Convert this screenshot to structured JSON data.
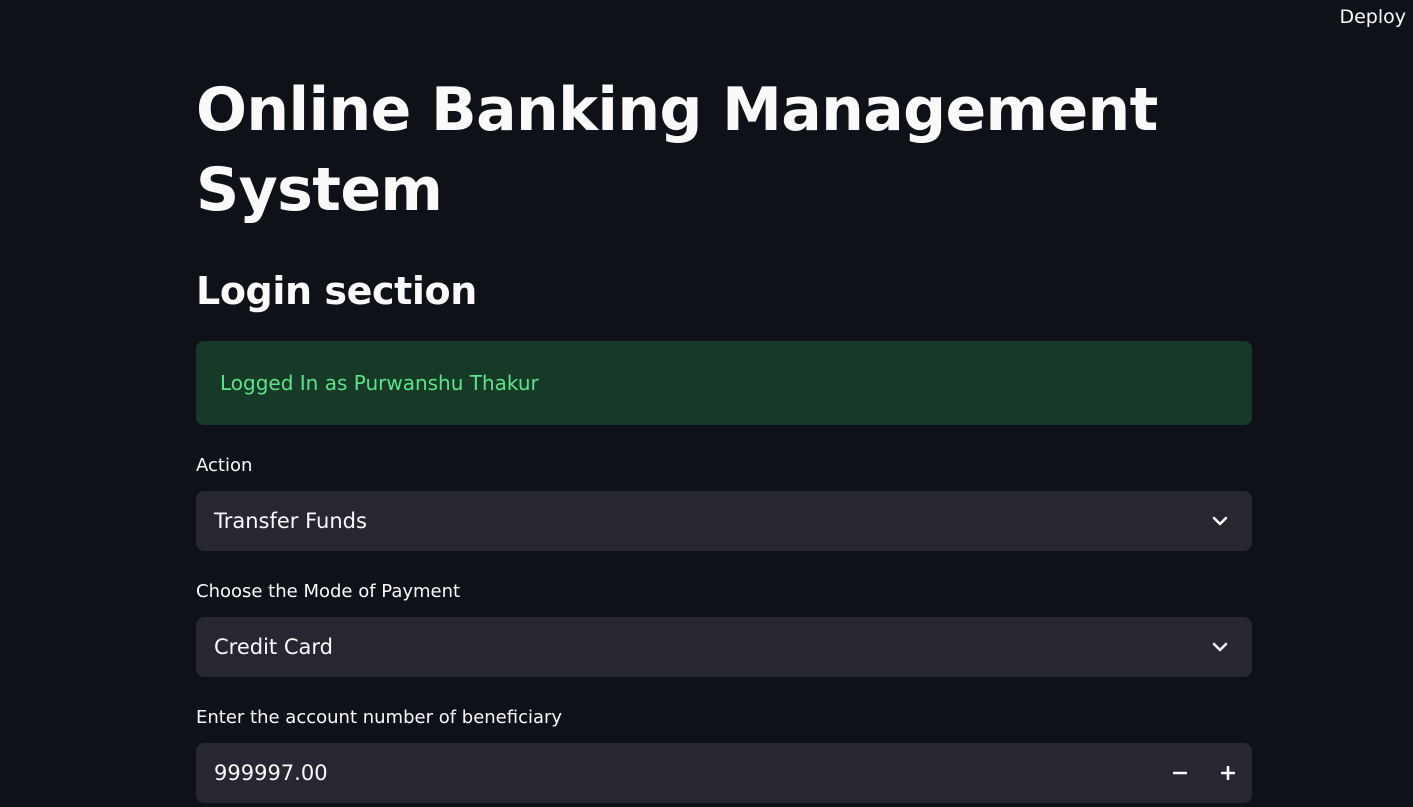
{
  "header": {
    "deploy_label": "Deploy"
  },
  "main": {
    "title": "Online Banking Management System",
    "login_section_heading": "Login section",
    "success_message": "Logged In as Purwanshu Thakur",
    "action": {
      "label": "Action",
      "selected": "Transfer Funds"
    },
    "payment_mode": {
      "label": "Choose the Mode of Payment",
      "selected": "Credit Card"
    },
    "beneficiary_account": {
      "label": "Enter the account number of beneficiary",
      "value": "999997.00"
    }
  },
  "colors": {
    "background": "#0e1117",
    "input_background": "#262730",
    "success_background": "#173928",
    "success_text": "#5ce488",
    "text": "#fafafa"
  },
  "icons": {
    "dropdown": "chevron-down-icon",
    "decrement": "minus-icon",
    "increment": "plus-icon"
  }
}
